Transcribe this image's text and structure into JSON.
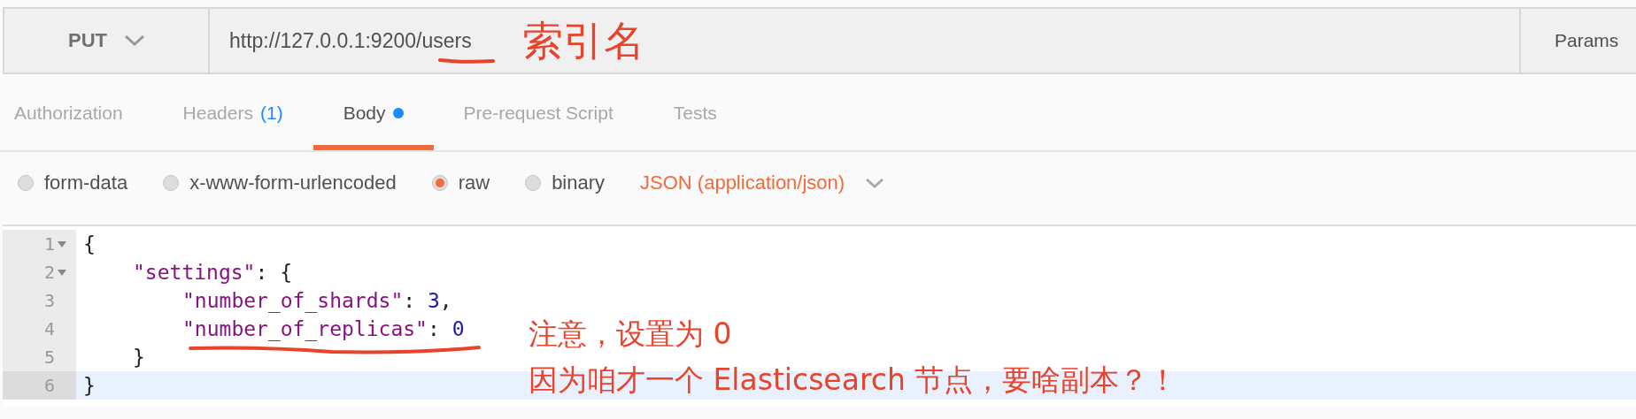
{
  "request": {
    "method": "PUT",
    "url": "http://127.0.0.1:9200/users",
    "params_label": "Params"
  },
  "tabs": [
    {
      "label": "Authorization",
      "selected": false,
      "modified": false
    },
    {
      "label": "Headers",
      "count": "(1)",
      "selected": false,
      "modified": false
    },
    {
      "label": "Body",
      "selected": true,
      "modified": true
    },
    {
      "label": "Pre-request Script",
      "selected": false,
      "modified": false
    },
    {
      "label": "Tests",
      "selected": false,
      "modified": false
    }
  ],
  "body_types": [
    {
      "label": "form-data",
      "selected": false
    },
    {
      "label": "x-www-form-urlencoded",
      "selected": false
    },
    {
      "label": "raw",
      "selected": true
    },
    {
      "label": "binary",
      "selected": false
    }
  ],
  "content_type": "JSON (application/json)",
  "editor": {
    "lines": [
      {
        "number": "1",
        "foldable": true,
        "selected": false,
        "tokens": [
          {
            "kind": "punct",
            "text": "{"
          }
        ],
        "children": [
          {
            "number": "2",
            "foldable": true,
            "selected": false,
            "tokens": [
              {
                "kind": "key",
                "text": "\"settings\""
              },
              {
                "kind": "punct",
                "text": ": {"
              }
            ],
            "children": [
              {
                "number": "3",
                "foldable": false,
                "selected": false,
                "tokens": [
                  {
                    "kind": "key",
                    "text": "\"number_of_shards\""
                  },
                  {
                    "kind": "punct",
                    "text": ": "
                  },
                  {
                    "kind": "number",
                    "text": "3"
                  },
                  {
                    "kind": "punct",
                    "text": ","
                  }
                ]
              },
              {
                "number": "4",
                "foldable": false,
                "selected": false,
                "tokens": [
                  {
                    "kind": "key",
                    "text": "\"number_of_replicas\""
                  },
                  {
                    "kind": "punct",
                    "text": ": "
                  },
                  {
                    "kind": "number",
                    "text": "0"
                  }
                ]
              }
            ]
          },
          {
            "number": "5",
            "foldable": false,
            "selected": false,
            "tokens": [
              {
                "kind": "punct",
                "text": "}"
              }
            ]
          }
        ]
      },
      {
        "number": "6",
        "foldable": false,
        "selected": true,
        "tokens": [
          {
            "kind": "punct",
            "text": "}"
          }
        ]
      }
    ]
  },
  "annotations": [
    {
      "kind": "label",
      "text": "索引名"
    },
    {
      "kind": "note",
      "lines": [
        "注意，设置为 0",
        "因为咱才一个 Elasticsearch 节点，要啥副本？！"
      ]
    }
  ]
}
